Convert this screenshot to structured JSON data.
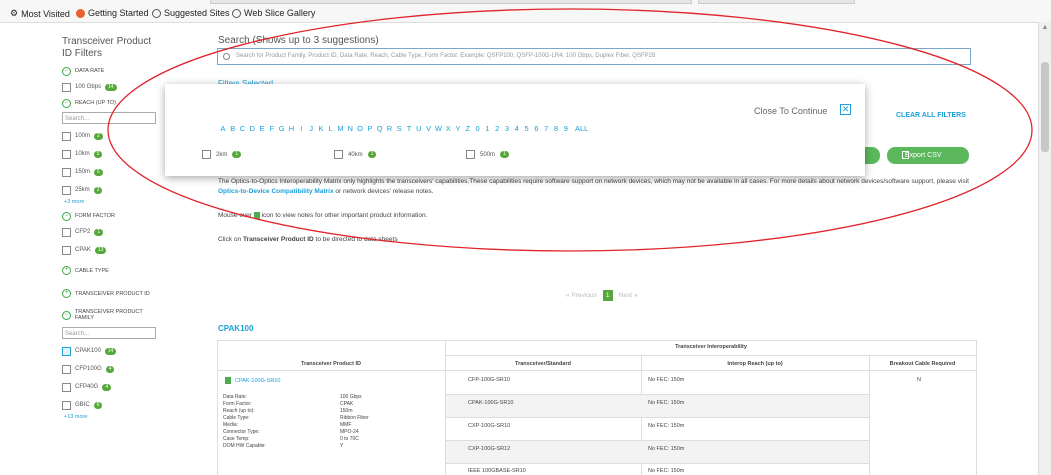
{
  "bookmarks": [
    {
      "label": "Most Visited",
      "icon": "gear-icon"
    },
    {
      "label": "Getting Started",
      "icon": "firefox-icon"
    },
    {
      "label": "Suggested Sites",
      "icon": "globe-icon"
    },
    {
      "label": "Web Slice Gallery",
      "icon": "globe-icon"
    }
  ],
  "sidebar": {
    "title": "Transceiver Product ID Filters",
    "data_rate": {
      "label": "DATA RATE",
      "options": [
        {
          "label": "100 Gbps",
          "count": "14"
        }
      ]
    },
    "reach": {
      "label": "REACH (up to)",
      "search_placeholder": "Search...",
      "options": [
        {
          "label": "100m",
          "count": "2"
        },
        {
          "label": "10km",
          "count": "5"
        },
        {
          "label": "150m",
          "count": "5"
        },
        {
          "label": "25km",
          "count": "3"
        }
      ],
      "more": "+3 more"
    },
    "form_factor": {
      "label": "FORM FACTOR",
      "options": [
        {
          "label": "CFP2",
          "count": "1"
        },
        {
          "label": "CPAK",
          "count": "13"
        }
      ]
    },
    "cable_type": {
      "label": "CABLE TYPE"
    },
    "product_id": {
      "label": "TRANSCEIVER PRODUCT ID"
    },
    "product_family": {
      "label": "TRANSCEIVER PRODUCT FAMILY",
      "search_placeholder": "Search...",
      "options": [
        {
          "label": "CPAK100",
          "count": "14",
          "checked": true
        },
        {
          "label": "CFP100G",
          "count": "4"
        },
        {
          "label": "CFP40G",
          "count": "4"
        },
        {
          "label": "GBIC",
          "count": "6"
        }
      ],
      "more": "+13 more"
    }
  },
  "main": {
    "search_title": "Search (Shows up to 3 suggestions)",
    "search_placeholder": "Search for Product Family, Product ID, Data Rate, Reach, Cable Type, Form Factor.  Example: QSFP100, QSFP-100G-LR4, 100 Gbps, Duplex Fiber, QSFP28",
    "filters_selected": "Filters Selected",
    "clear_all": "CLEAR ALL FILTERS",
    "export_csv": "Export CSV",
    "para1": "The Optics-to-Optics Interoperability Matrix only highlights the transceivers' capabilities.These capabilities require software support on network devices, which may not be available in all cases. For more details about network devices/software support, please visit ",
    "para1_link": "Optics-to-Device Compatibility Matrix",
    "para1_tail": " or network devices' release notes.",
    "para2_a": "Mouse over ",
    "para2_b": " icon to view notes for other important product information.",
    "para3_a": "Click on ",
    "para3_b": "Transceiver Product ID",
    "para3_c": " to be directed to data sheets",
    "pager": {
      "prev": "« Previous",
      "current": "1",
      "next": "Next »"
    },
    "family_title": "CPAK100"
  },
  "table": {
    "group_header": "Transceiver Interoperability",
    "headers": [
      "Transceiver Product ID",
      "Transceiver/Standard",
      "Interop Reach (up to)",
      "Breakout Cable Required"
    ],
    "product_id": "CPAK-100G-SR10",
    "breakout": "N",
    "details": [
      [
        "Data Rate:",
        "100 Gbps"
      ],
      [
        "Form Factor:",
        "CPAK"
      ],
      [
        "Reach (up to):",
        "150m"
      ],
      [
        "Cable Type:",
        "Ribbon Fiber"
      ],
      [
        "Media:",
        "MMF"
      ],
      [
        "Connector Type:",
        "MPO-24"
      ],
      [
        "Case Temp:",
        "0 to 70C"
      ],
      [
        "DOM HW Capable:",
        "Y"
      ]
    ],
    "rows": [
      {
        "standard": "CFP-100G-SR10",
        "reach": "No FEC: 150m"
      },
      {
        "standard": "CPAK-100G-SR10",
        "reach": "No FEC: 150m"
      },
      {
        "standard": "CXP-100G-SR10",
        "reach": "No FEC: 150m"
      },
      {
        "standard": "CXP-100G-SR12",
        "reach": "No FEC: 150m"
      },
      {
        "standard": "IEEE 100GBASE-SR10",
        "reach": "No FEC: 150m"
      }
    ]
  },
  "overlay": {
    "close_label": "Close To Continue",
    "close_icon": "close-icon",
    "letters": [
      "A",
      "B",
      "C",
      "D",
      "E",
      "F",
      "G",
      "H",
      "I",
      "J",
      "K",
      "L",
      "M",
      "N",
      "O",
      "P",
      "Q",
      "R",
      "S",
      "T",
      "U",
      "V",
      "W",
      "X",
      "Y",
      "Z",
      "0",
      "1",
      "2",
      "3",
      "4",
      "5",
      "6",
      "7",
      "8",
      "9",
      "ALL"
    ],
    "options": [
      {
        "label": "2km",
        "count": "1"
      },
      {
        "label": "40km",
        "count": "1"
      },
      {
        "label": "500m",
        "count": "1"
      }
    ]
  },
  "colors": {
    "accent": "#1ba0d7",
    "green": "#56a83b",
    "annotation": "#e0242b"
  }
}
